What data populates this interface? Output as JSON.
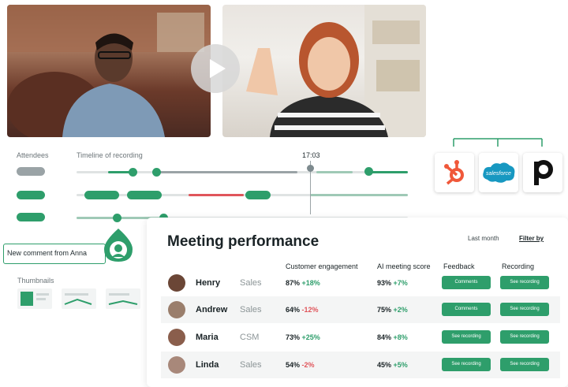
{
  "colors": {
    "accent": "#2e9e6b",
    "negative": "#e0555b"
  },
  "timeline": {
    "attendees_label": "Attendees",
    "timeline_label": "Timeline of recording",
    "current_time": "17:03"
  },
  "comment": {
    "text": "New comment from Anna"
  },
  "thumbnails": {
    "label": "Thumbnails"
  },
  "integrations": [
    "hubspot-icon",
    "salesforce-icon",
    "pipedrive-icon"
  ],
  "performance": {
    "title": "Meeting performance",
    "period": "Last month",
    "filter": "Filter by",
    "columns": [
      "Customer engagement",
      "AI meeting score",
      "Feedback",
      "Recording"
    ],
    "rows": [
      {
        "name": "Henry",
        "dept": "Sales",
        "engagement": "87%",
        "engagement_delta": "+18%",
        "score": "93%",
        "score_delta": "+7%",
        "feedback": "Comments",
        "recording": "See recording"
      },
      {
        "name": "Andrew",
        "dept": "Sales",
        "engagement": "64%",
        "engagement_delta": "-12%",
        "score": "75%",
        "score_delta": "+2%",
        "feedback": "Comments",
        "recording": "See recording"
      },
      {
        "name": "Maria",
        "dept": "CSM",
        "engagement": "73%",
        "engagement_delta": "+25%",
        "score": "84%",
        "score_delta": "+8%",
        "feedback": "See recording",
        "recording": "See recording"
      },
      {
        "name": "Linda",
        "dept": "Sales",
        "engagement": "54%",
        "engagement_delta": "-2%",
        "score": "45%",
        "score_delta": "+5%",
        "feedback": "See recording",
        "recording": "See recording"
      }
    ]
  }
}
